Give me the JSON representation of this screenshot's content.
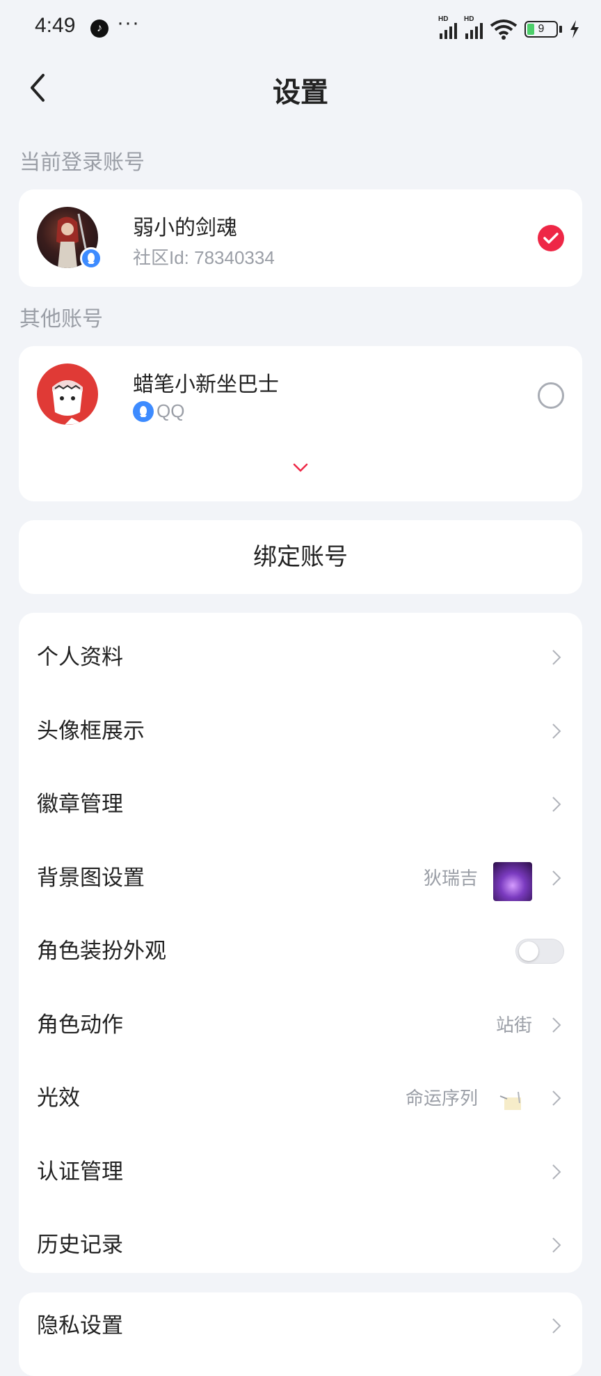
{
  "status_bar": {
    "time": "4:49",
    "dots": "···",
    "battery": "9",
    "net1": "HD",
    "net2": "HD"
  },
  "header": {
    "title": "设置"
  },
  "current_account": {
    "section_label": "当前登录账号",
    "name": "弱小的剑魂",
    "sub": "社区Id: 78340334"
  },
  "other_accounts": {
    "section_label": "其他账号",
    "items": [
      {
        "name": "蜡笔小新坐巴士",
        "platform": "QQ"
      }
    ]
  },
  "bind_button": "绑定账号",
  "menu": [
    {
      "label": "个人资料"
    },
    {
      "label": "头像框展示"
    },
    {
      "label": "徽章管理"
    },
    {
      "label": "背景图设置",
      "value": "狄瑞吉"
    },
    {
      "label": "角色装扮外观",
      "toggle": false
    },
    {
      "label": "角色动作",
      "value": "站街"
    },
    {
      "label": "光效",
      "value": "命运序列"
    },
    {
      "label": "认证管理"
    },
    {
      "label": "历史记录"
    }
  ],
  "menu2": [
    {
      "label": "隐私设置"
    }
  ],
  "colors": {
    "background": "#f2f4f8",
    "accent_red": "#ee2746",
    "qq_blue": "#3d8bff"
  }
}
